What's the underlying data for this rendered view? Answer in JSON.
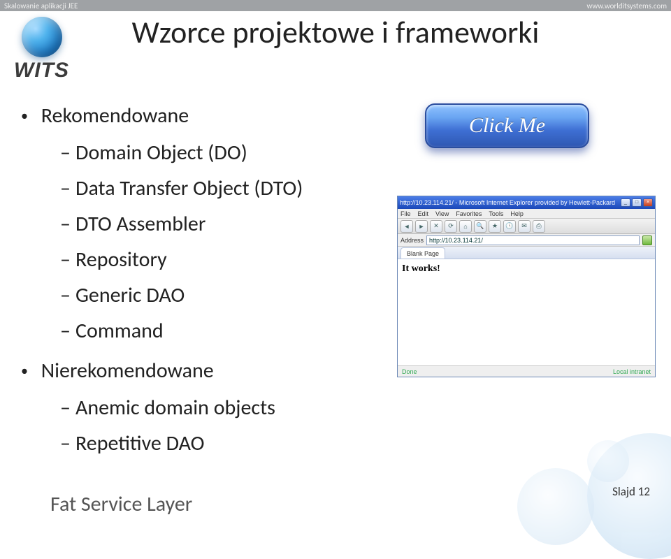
{
  "header": {
    "left": "Skalowanie aplikacji JEE",
    "right": "www.worlditsystems.com"
  },
  "logo": {
    "text": "WITS",
    "sub": ""
  },
  "title": "Wzorce projektowe i frameworki",
  "bullets": {
    "rekomendowane": {
      "label": "Rekomendowane",
      "items": [
        "Domain Object (DO)",
        "Data Transfer Object (DTO)",
        "DTO Assembler",
        "Repository",
        "Generic DAO",
        "Command"
      ]
    },
    "nierekomendowane": {
      "label": "Nierekomendowane",
      "items": [
        "Anemic domain objects",
        "Repetitive DAO"
      ]
    }
  },
  "clickme": "Click Me",
  "browser": {
    "titlebar": "http://10.23.114.21/ - Microsoft Internet Explorer provided by Hewlett-Packard",
    "menu": [
      "File",
      "Edit",
      "View",
      "Favorites",
      "Tools",
      "Help"
    ],
    "address_label": "Address",
    "address": "http://10.23.114.21/",
    "tab": "Blank Page",
    "page_text": "It works!",
    "status_left": "Done",
    "status_right": "Local intranet"
  },
  "footer": "Slajd 12",
  "cutoff": "Fat Service Layer"
}
